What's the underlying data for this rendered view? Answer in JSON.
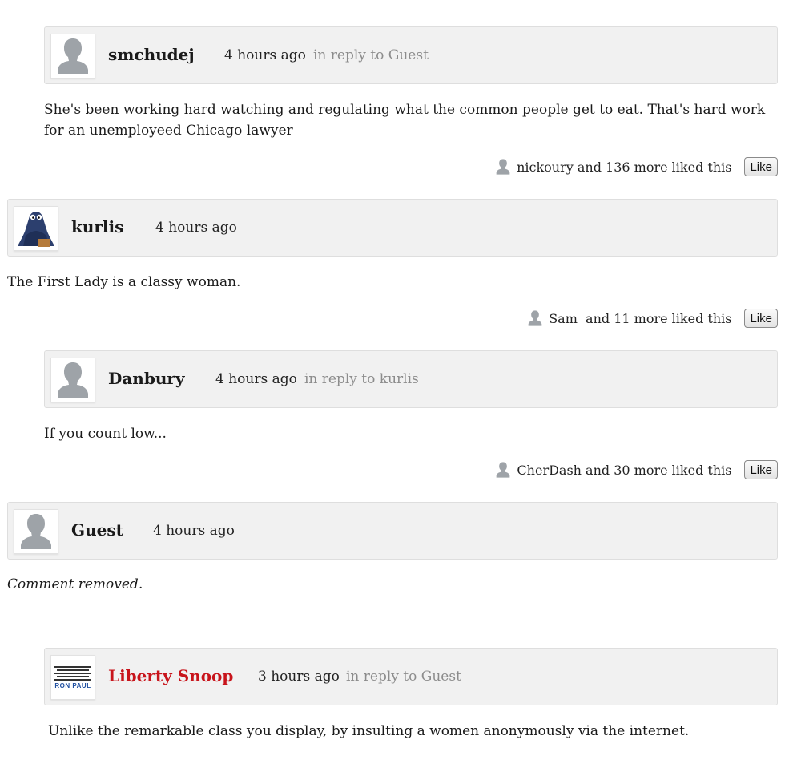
{
  "like_label": "Like",
  "comments": [
    {
      "username": "smchudej",
      "time": "4 hours ago",
      "reply_to": "in reply to Guest",
      "text": "She's been working hard watching and regulating what the common people get to eat.  That's hard work for an unemployeed Chicago lawyer",
      "likes_text": "nickoury and 136 more liked this"
    },
    {
      "username": "kurlis",
      "time": "4 hours ago",
      "text": "The First Lady is a classy woman.",
      "likes_text": "Sam  and 11 more liked this"
    },
    {
      "username": "Danbury",
      "time": "4 hours ago",
      "reply_to": "in reply to kurlis",
      "text": "If you count low...",
      "likes_text": "CherDash and 30 more liked this"
    },
    {
      "username": "Guest",
      "time": "4 hours ago",
      "text": "Comment removed."
    },
    {
      "username": "Liberty Snoop",
      "time": "3 hours ago",
      "reply_to": "in reply to Guest",
      "text": "Unlike the remarkable class you display, by insulting a women anonymously via the internet.",
      "avatar_text": "RON PAUL",
      "name_color": "#c8141b"
    }
  ]
}
